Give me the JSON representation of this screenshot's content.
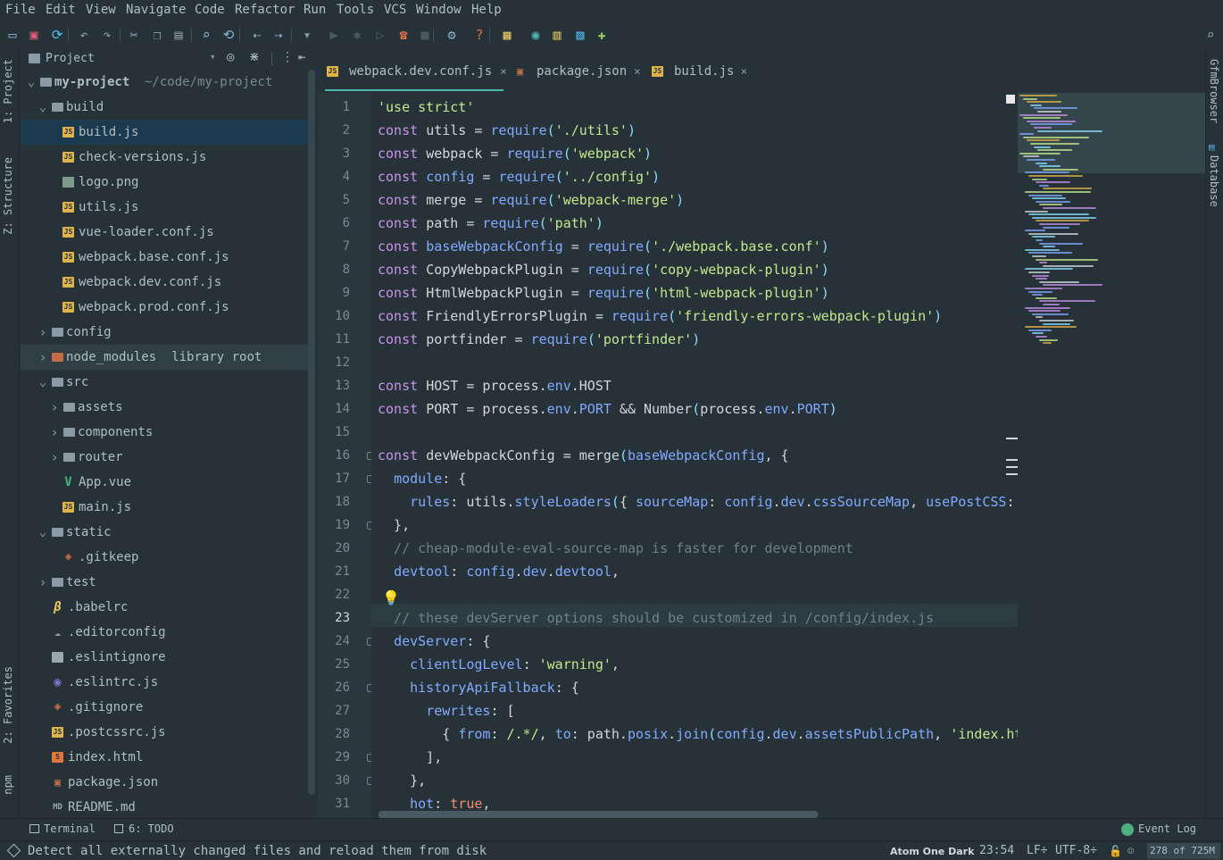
{
  "menu": [
    "File",
    "Edit",
    "View",
    "Navigate",
    "Code",
    "Refactor",
    "Run",
    "Tools",
    "VCS",
    "Window",
    "Help"
  ],
  "toolbar_icons": [
    "open-folder-icon",
    "save-icon",
    "sync-icon",
    "undo-icon",
    "redo-icon",
    "cut-icon",
    "copy-icon",
    "paste-icon",
    "find-icon",
    "replace-icon",
    "back-icon",
    "forward-icon",
    "run-config-dropdown-icon",
    "run-icon",
    "debug-icon",
    "coverage-icon",
    "attach-icon",
    "stop-icon",
    "settings-icon",
    "help-icon",
    "sdk-icon",
    "tasks-icon",
    "structure-icon",
    "layout-icon",
    "plugins-icon",
    "search-everywhere-icon"
  ],
  "left_tabs": {
    "project": "1: Project",
    "structure": "Z: Structure",
    "favorites": "2: Favorites",
    "npm": "npm"
  },
  "right_tabs": {
    "gfm": "GfmBrowser",
    "database": "Database"
  },
  "project_panel": {
    "title": "Project",
    "tree": [
      {
        "label": "my-project",
        "extra": "~/code/my-project",
        "icon": "folder",
        "depth": 0,
        "arrow": "v",
        "bold": true
      },
      {
        "label": "build",
        "icon": "folder",
        "depth": 1,
        "arrow": "v"
      },
      {
        "label": "build.js",
        "icon": "js",
        "depth": 2,
        "selected": true
      },
      {
        "label": "check-versions.js",
        "icon": "js",
        "depth": 2
      },
      {
        "label": "logo.png",
        "icon": "png",
        "depth": 2
      },
      {
        "label": "utils.js",
        "icon": "js",
        "depth": 2
      },
      {
        "label": "vue-loader.conf.js",
        "icon": "js",
        "depth": 2
      },
      {
        "label": "webpack.base.conf.js",
        "icon": "js",
        "depth": 2
      },
      {
        "label": "webpack.dev.conf.js",
        "icon": "js",
        "depth": 2
      },
      {
        "label": "webpack.prod.conf.js",
        "icon": "js",
        "depth": 2
      },
      {
        "label": "config",
        "icon": "folder",
        "depth": 1,
        "arrow": ">"
      },
      {
        "label": "node_modules",
        "extra": "library root",
        "icon": "folder-or",
        "depth": 1,
        "arrow": ">",
        "hl": true
      },
      {
        "label": "src",
        "icon": "folder",
        "depth": 1,
        "arrow": "v"
      },
      {
        "label": "assets",
        "icon": "folder",
        "depth": 2,
        "arrow": ">"
      },
      {
        "label": "components",
        "icon": "folder",
        "depth": 2,
        "arrow": ">"
      },
      {
        "label": "router",
        "icon": "folder",
        "depth": 2,
        "arrow": ">"
      },
      {
        "label": "App.vue",
        "icon": "vue",
        "depth": 2
      },
      {
        "label": "main.js",
        "icon": "js",
        "depth": 2
      },
      {
        "label": "static",
        "icon": "folder",
        "depth": 1,
        "arrow": "v"
      },
      {
        "label": ".gitkeep",
        "icon": "git",
        "depth": 2
      },
      {
        "label": "test",
        "icon": "folder",
        "depth": 1,
        "arrow": ">"
      },
      {
        "label": ".babelrc",
        "icon": "babel",
        "depth": 1
      },
      {
        "label": ".editorconfig",
        "icon": "cfg",
        "depth": 1
      },
      {
        "label": ".eslintignore",
        "icon": "txt",
        "depth": 1
      },
      {
        "label": ".eslintrc.js",
        "icon": "esl",
        "depth": 1
      },
      {
        "label": ".gitignore",
        "icon": "git",
        "depth": 1
      },
      {
        "label": ".postcssrc.js",
        "icon": "js",
        "depth": 1
      },
      {
        "label": "index.html",
        "icon": "html",
        "depth": 1
      },
      {
        "label": "package.json",
        "icon": "pkg",
        "depth": 1
      },
      {
        "label": "README.md",
        "icon": "md",
        "depth": 1
      }
    ]
  },
  "tabs": [
    {
      "label": "webpack.dev.conf.js",
      "icon": "js",
      "active": true
    },
    {
      "label": "package.json",
      "icon": "pkg"
    },
    {
      "label": "build.js",
      "icon": "js"
    }
  ],
  "current_line": 23,
  "code": [
    [
      [
        "s",
        "'use strict'"
      ]
    ],
    [
      [
        "k",
        "const "
      ],
      [
        "w",
        "utils = "
      ],
      [
        "f",
        "require"
      ],
      [
        "p",
        "("
      ],
      [
        "s",
        "'./utils'"
      ],
      [
        "p",
        ")"
      ]
    ],
    [
      [
        "k",
        "const "
      ],
      [
        "w",
        "webpack = "
      ],
      [
        "f",
        "require"
      ],
      [
        "p",
        "("
      ],
      [
        "s",
        "'webpack'"
      ],
      [
        "p",
        ")"
      ]
    ],
    [
      [
        "k",
        "const "
      ],
      [
        "f",
        "config"
      ],
      [
        "w",
        " = "
      ],
      [
        "f",
        "require"
      ],
      [
        "p",
        "("
      ],
      [
        "s",
        "'../config'"
      ],
      [
        "p",
        ")"
      ]
    ],
    [
      [
        "k",
        "const "
      ],
      [
        "w",
        "merge = "
      ],
      [
        "f",
        "require"
      ],
      [
        "p",
        "("
      ],
      [
        "s",
        "'webpack-merge'"
      ],
      [
        "p",
        ")"
      ]
    ],
    [
      [
        "k",
        "const "
      ],
      [
        "w",
        "path = "
      ],
      [
        "f",
        "require"
      ],
      [
        "p",
        "("
      ],
      [
        "s",
        "'path'"
      ],
      [
        "p",
        ")"
      ]
    ],
    [
      [
        "k",
        "const "
      ],
      [
        "f",
        "baseWebpackConfig"
      ],
      [
        "w",
        " = "
      ],
      [
        "f",
        "require"
      ],
      [
        "p",
        "("
      ],
      [
        "s",
        "'./webpack.base.conf'"
      ],
      [
        "p",
        ")"
      ]
    ],
    [
      [
        "k",
        "const "
      ],
      [
        "w",
        "CopyWebpackPlugin = "
      ],
      [
        "f",
        "require"
      ],
      [
        "p",
        "("
      ],
      [
        "s",
        "'copy-webpack-plugin'"
      ],
      [
        "p",
        ")"
      ]
    ],
    [
      [
        "k",
        "const "
      ],
      [
        "w",
        "HtmlWebpackPlugin = "
      ],
      [
        "f",
        "require"
      ],
      [
        "p",
        "("
      ],
      [
        "s",
        "'html-webpack-plugin'"
      ],
      [
        "p",
        ")"
      ]
    ],
    [
      [
        "k",
        "const "
      ],
      [
        "w",
        "FriendlyErrorsPlugin = "
      ],
      [
        "f",
        "require"
      ],
      [
        "p",
        "("
      ],
      [
        "s",
        "'friendly-errors-webpack-plugin'"
      ],
      [
        "p",
        ")"
      ]
    ],
    [
      [
        "k",
        "const "
      ],
      [
        "w",
        "portfinder = "
      ],
      [
        "f",
        "require"
      ],
      [
        "p",
        "("
      ],
      [
        "s",
        "'portfinder'"
      ],
      [
        "p",
        ")"
      ]
    ],
    [],
    [
      [
        "k",
        "const "
      ],
      [
        "w",
        "HOST = process."
      ],
      [
        "f",
        "env"
      ],
      [
        "w",
        ".HOST"
      ]
    ],
    [
      [
        "k",
        "const "
      ],
      [
        "w",
        "PORT = process."
      ],
      [
        "f",
        "env"
      ],
      [
        "w",
        "."
      ],
      [
        "f",
        "PORT"
      ],
      [
        "w",
        " && Number"
      ],
      [
        "p",
        "("
      ],
      [
        "w",
        "process."
      ],
      [
        "f",
        "env"
      ],
      [
        "w",
        "."
      ],
      [
        "f",
        "PORT"
      ],
      [
        "p",
        ")"
      ]
    ],
    [],
    [
      [
        "k",
        "const "
      ],
      [
        "w",
        "devWebpackConfig = merge"
      ],
      [
        "p",
        "("
      ],
      [
        "f",
        "baseWebpackConfig"
      ],
      [
        "w",
        ", {"
      ]
    ],
    [
      [
        "w",
        "  "
      ],
      [
        "f",
        "module"
      ],
      [
        "w",
        ": {"
      ]
    ],
    [
      [
        "w",
        "    "
      ],
      [
        "f",
        "rules"
      ],
      [
        "w",
        ": utils."
      ],
      [
        "f",
        "styleLoaders"
      ],
      [
        "p",
        "("
      ],
      [
        "w",
        "{ "
      ],
      [
        "f",
        "sourceMap"
      ],
      [
        "w",
        ": "
      ],
      [
        "f",
        "config"
      ],
      [
        "w",
        "."
      ],
      [
        "f",
        "dev"
      ],
      [
        "w",
        "."
      ],
      [
        "f",
        "cssSourceMap"
      ],
      [
        "w",
        ", "
      ],
      [
        "f",
        "usePostCSS"
      ],
      [
        "w",
        ":"
      ]
    ],
    [
      [
        "w",
        "  },"
      ]
    ],
    [
      [
        "c",
        "  // cheap-module-eval-source-map is faster for development"
      ]
    ],
    [
      [
        "w",
        "  "
      ],
      [
        "f",
        "devtool"
      ],
      [
        "w",
        ": "
      ],
      [
        "f",
        "config"
      ],
      [
        "w",
        "."
      ],
      [
        "f",
        "dev"
      ],
      [
        "w",
        "."
      ],
      [
        "f",
        "devtool"
      ],
      [
        "w",
        ","
      ]
    ],
    [],
    [
      [
        "c",
        "  // these devServer options should be customized in /config/index.js"
      ]
    ],
    [
      [
        "w",
        "  "
      ],
      [
        "f",
        "devServer"
      ],
      [
        "w",
        ": {"
      ]
    ],
    [
      [
        "w",
        "    "
      ],
      [
        "f",
        "clientLogLevel"
      ],
      [
        "w",
        ": "
      ],
      [
        "s",
        "'warning'"
      ],
      [
        "w",
        ","
      ]
    ],
    [
      [
        "w",
        "    "
      ],
      [
        "f",
        "historyApiFallback"
      ],
      [
        "w",
        ": {"
      ]
    ],
    [
      [
        "w",
        "      "
      ],
      [
        "f",
        "rewrites"
      ],
      [
        "w",
        ": ["
      ]
    ],
    [
      [
        "w",
        "        { "
      ],
      [
        "f",
        "from"
      ],
      [
        "w",
        ": "
      ],
      [
        "s",
        "/.*/"
      ],
      [
        "w",
        ", "
      ],
      [
        "f",
        "to"
      ],
      [
        "w",
        ": path."
      ],
      [
        "f",
        "posix"
      ],
      [
        "w",
        "."
      ],
      [
        "f",
        "join"
      ],
      [
        "p",
        "("
      ],
      [
        "f",
        "config"
      ],
      [
        "w",
        "."
      ],
      [
        "f",
        "dev"
      ],
      [
        "w",
        "."
      ],
      [
        "f",
        "assetsPublicPath"
      ],
      [
        "w",
        ", "
      ],
      [
        "s",
        "'index.ht"
      ]
    ],
    [
      [
        "w",
        "      ],"
      ]
    ],
    [
      [
        "w",
        "    },"
      ]
    ],
    [
      [
        "w",
        "    "
      ],
      [
        "f",
        "hot"
      ],
      [
        "w",
        ": "
      ],
      [
        "b",
        "true"
      ],
      [
        "w",
        ","
      ]
    ]
  ],
  "bottom_tabs": {
    "terminal": "Terminal",
    "todo": "6: TODO",
    "event_log": "Event Log"
  },
  "status": {
    "message": "Detect all externally changed files and reload them from disk",
    "theme": "Atom One Dark",
    "position": "23:54",
    "line_sep": "LF÷",
    "encoding": "UTF-8÷",
    "memory": "278 of 725M"
  }
}
